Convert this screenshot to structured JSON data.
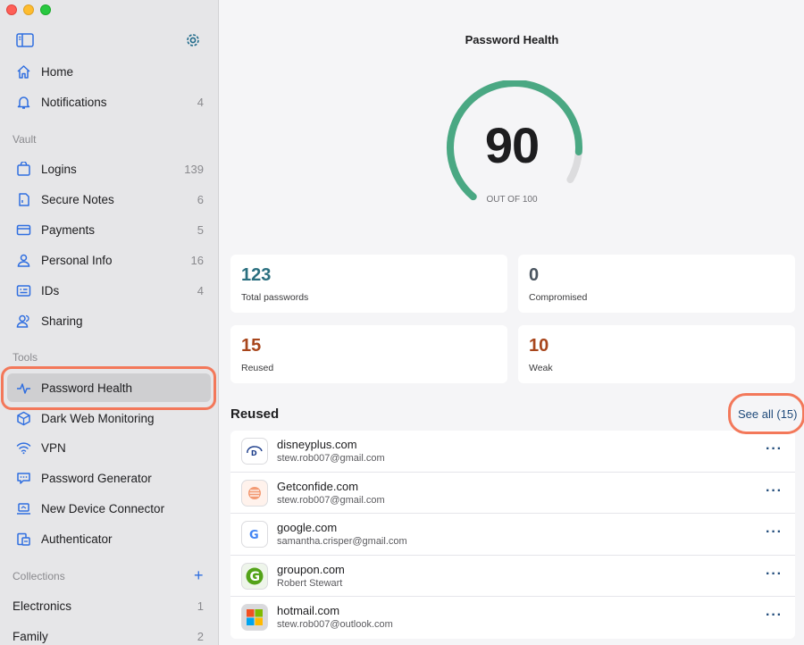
{
  "sidebar": {
    "home": "Home",
    "notifications": {
      "label": "Notifications",
      "count": "4"
    },
    "vault_header": "Vault",
    "vault": [
      {
        "label": "Logins",
        "count": "139",
        "icon": "login-icon"
      },
      {
        "label": "Secure Notes",
        "count": "6",
        "icon": "note-icon"
      },
      {
        "label": "Payments",
        "count": "5",
        "icon": "card-icon"
      },
      {
        "label": "Personal Info",
        "count": "16",
        "icon": "person-icon"
      },
      {
        "label": "IDs",
        "count": "4",
        "icon": "id-icon"
      },
      {
        "label": "Sharing",
        "count": "",
        "icon": "sharing-icon"
      }
    ],
    "tools_header": "Tools",
    "tools": [
      {
        "label": "Password Health",
        "icon": "pulse-icon"
      },
      {
        "label": "Dark Web Monitoring",
        "icon": "globe-icon"
      },
      {
        "label": "VPN",
        "icon": "wifi-icon"
      },
      {
        "label": "Password Generator",
        "icon": "generator-icon"
      },
      {
        "label": "New Device Connector",
        "icon": "laptop-icon"
      },
      {
        "label": "Authenticator",
        "icon": "authenticator-icon"
      }
    ],
    "collections_header": "Collections",
    "collections_add": "+",
    "collections": [
      {
        "label": "Electronics",
        "count": "1"
      },
      {
        "label": "Family",
        "count": "2"
      }
    ]
  },
  "main": {
    "title": "Password Health",
    "score": "90",
    "score_caption": "OUT OF 100",
    "score_fraction": 0.9,
    "stats": [
      {
        "value": "123",
        "label": "Total passwords",
        "color": "#2a6f7f"
      },
      {
        "value": "0",
        "label": "Compromised",
        "color": "#4a5560"
      },
      {
        "value": "15",
        "label": "Reused",
        "color": "#a8461c"
      },
      {
        "value": "10",
        "label": "Weak",
        "color": "#a8461c"
      }
    ],
    "reused_title": "Reused",
    "see_all": "See all (15)",
    "reused": [
      {
        "site": "disneyplus.com",
        "user": "stew.rob007@gmail.com",
        "icon": "disney-icon"
      },
      {
        "site": "Getconfide.com",
        "user": "stew.rob007@gmail.com",
        "icon": "confide-icon"
      },
      {
        "site": "google.com",
        "user": "samantha.crisper@gmail.com",
        "icon": "google-icon"
      },
      {
        "site": "groupon.com",
        "user": "Robert Stewart",
        "icon": "groupon-icon"
      },
      {
        "site": "hotmail.com",
        "user": "stew.rob007@outlook.com",
        "icon": "hotmail-icon"
      }
    ],
    "more_glyph": "···"
  },
  "colors": {
    "accent": "#2f6ee0",
    "gauge": "#4aa883",
    "gauge_track": "#dcdcde",
    "highlight": "#f3785a"
  }
}
